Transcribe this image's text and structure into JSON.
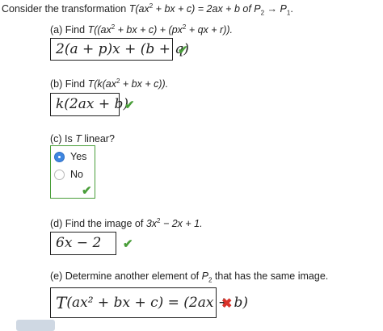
{
  "header": {
    "lead": "Consider the transformation",
    "T": "T",
    "open": "(ax",
    "exp": "2",
    "mid": " + bx + c) = 2ax + b  of ",
    "P": "P",
    "sub_from": "2",
    "arrow": " → ",
    "P2": "P",
    "sub_to": "1",
    "end": "."
  },
  "parts": {
    "a": {
      "label": "(a) Find",
      "expr_T": "T",
      "expr1": "((ax",
      "exp1": "2",
      "expr2": " + bx + c) + (px",
      "exp2": "2",
      "expr3": " + qx + r)).",
      "answer": "2(a + p)x + (b + q)",
      "status": "✔"
    },
    "b": {
      "label": "(b) Find",
      "expr_T": "T",
      "expr1": "(k(ax",
      "exp1": "2",
      "expr2": " + bx + c)).",
      "answer": "k(2ax + b)",
      "status": "✔"
    },
    "c": {
      "label": "(c) Is",
      "expr_T": "T",
      "label_end": "linear?",
      "options": [
        "Yes",
        "No"
      ],
      "selected": "Yes",
      "status": "✔"
    },
    "d": {
      "label": "(d) Find the image of",
      "expr1": "3x",
      "exp1": "2",
      "expr2": " − 2x + 1.",
      "answer": "6x − 2",
      "status": "✔"
    },
    "e": {
      "label": "(e) Determine another element of",
      "P": "P",
      "sub": "2",
      "label_end": "that has the same image.",
      "answer_T": "T",
      "answer_rest": "(ax² + bx + c) = (2ax + b)",
      "status": "✖"
    }
  },
  "colors": {
    "correct": "#4a9e3a",
    "incorrect": "#d9322a",
    "radio_selected": "#3f86e0"
  }
}
